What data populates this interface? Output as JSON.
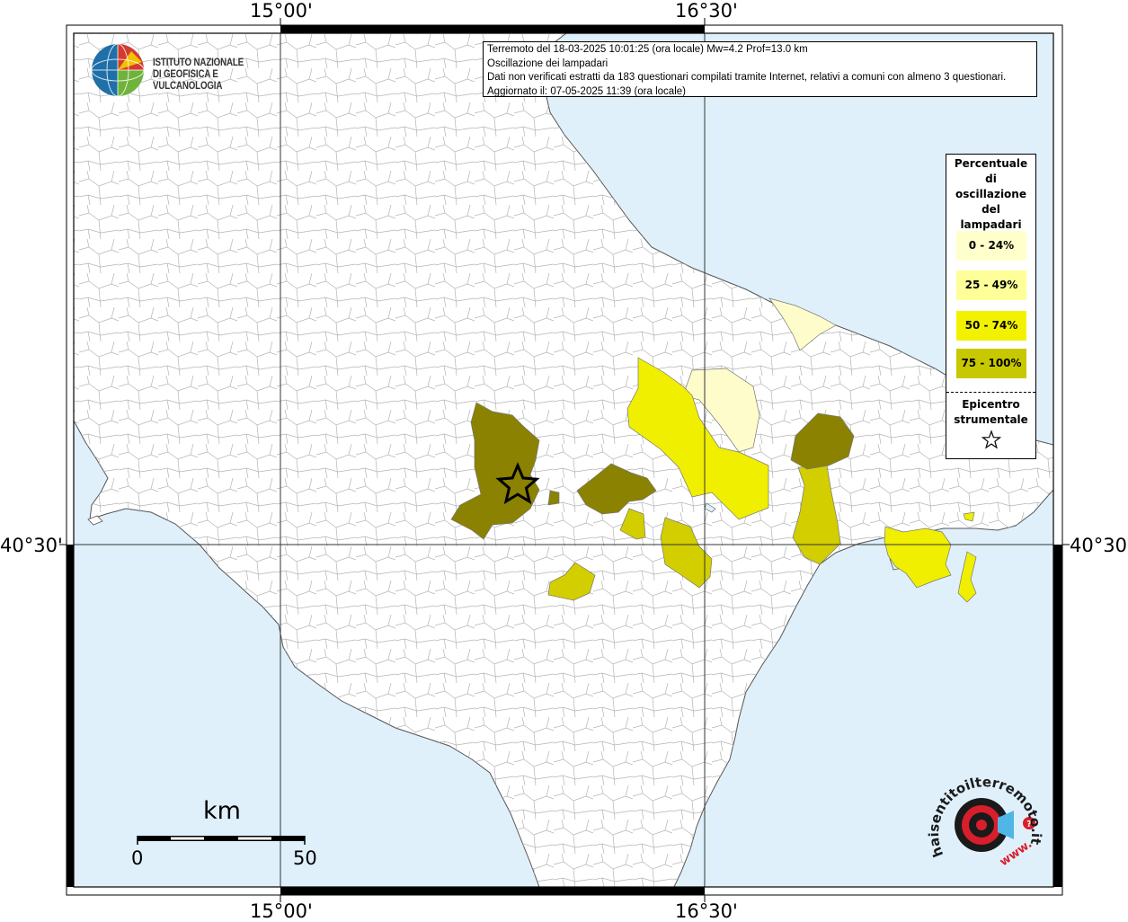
{
  "map": {
    "top_labels": [
      "15°00'",
      "16°30'"
    ],
    "bottom_labels": [
      "15°00'",
      "16°30'"
    ],
    "lat_label_left": "40°30'",
    "lat_label_right": "40°30'",
    "sea_color": "#dff0fb",
    "land_color": "#ffffff",
    "border_color": "#a9a9a9"
  },
  "info": {
    "line1": "Terremoto del 18-03-2025 10:01:25 (ora locale) Mw=4.2 Prof=13.0 km",
    "line2": "Oscillazione dei lampadari",
    "line3": "Dati non verificati estratti da 183 questionari compilati tramite Internet, relativi a comuni con almeno 3 questionari.",
    "line4": "Aggiornato il: 07-05-2025 11:39 (ora locale)"
  },
  "institute": {
    "line1": "ISTITUTO NAZIONALE",
    "line2": "DI GEOFISICA E VULCANOLOGIA"
  },
  "legend": {
    "title_lines": [
      "Percentuale",
      "di",
      "oscillazione",
      "del",
      "lampadari"
    ],
    "classes": [
      {
        "label": "0 - 24%",
        "color": "#ffffcc"
      },
      {
        "label": "25 - 49%",
        "color": "#ffff99"
      },
      {
        "label": "50 - 74%",
        "color": "#f2f200"
      },
      {
        "label": "75 - 100%",
        "color": "#c8c800"
      }
    ],
    "epicenter_lines": [
      "Epicentro",
      "strumentale"
    ]
  },
  "scale": {
    "unit": "km",
    "start": "0",
    "end": "50"
  },
  "hst_logo": {
    "text": "haisentitoilterremoto.it",
    "www": "www."
  },
  "region_colors": {
    "c0": "#fffccc",
    "c1": "#ffff99",
    "c2": "#f0ef00",
    "c3": "#d2ce00",
    "c4": "#8a8200"
  }
}
